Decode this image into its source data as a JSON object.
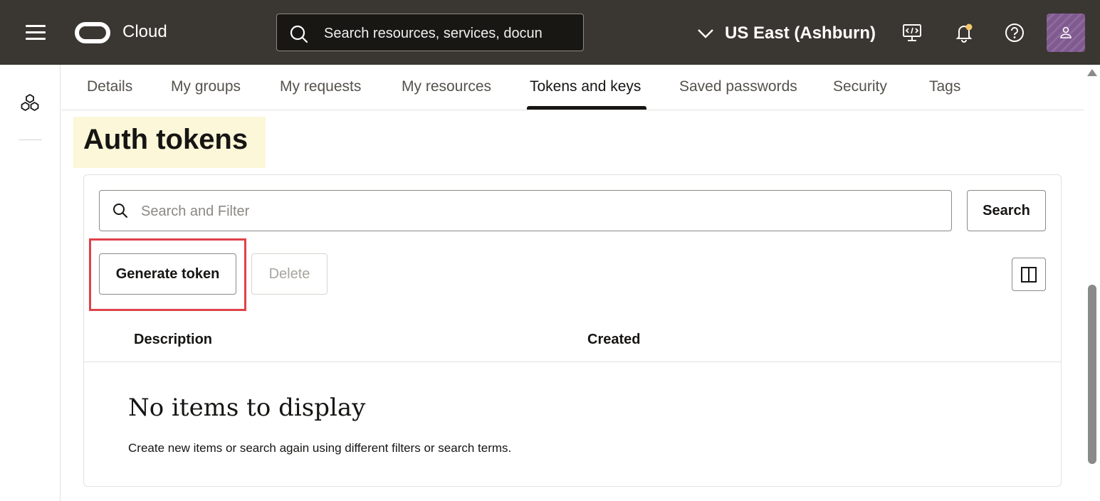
{
  "header": {
    "logo_text": "Cloud",
    "search_placeholder": "Search resources, services, docun",
    "region": "US East (Ashburn)",
    "icons": [
      "menu-icon",
      "oracle-logo",
      "search-icon",
      "chevron-down-icon",
      "cloud-shell-icon",
      "notifications-icon",
      "help-icon",
      "user-avatar-icon"
    ]
  },
  "tabs": [
    {
      "label": "Details"
    },
    {
      "label": "My groups"
    },
    {
      "label": "My requests"
    },
    {
      "label": "My resources"
    },
    {
      "label": "Tokens and keys",
      "active": true
    },
    {
      "label": "Saved passwords"
    },
    {
      "label": "Security"
    },
    {
      "label": "Tags"
    }
  ],
  "page": {
    "title": "Auth tokens"
  },
  "toolbar": {
    "filter_placeholder": "Search and Filter",
    "search_label": "Search",
    "generate_label": "Generate token",
    "delete_label": "Delete"
  },
  "table": {
    "columns": [
      "Description",
      "Created"
    ],
    "empty_title": "No items to display",
    "empty_subtitle": "Create new items or search again using different filters or search terms."
  },
  "colors": {
    "topbar": "#3a3631",
    "highlight": "#e0424a",
    "title_bg": "#fbf7d8"
  }
}
